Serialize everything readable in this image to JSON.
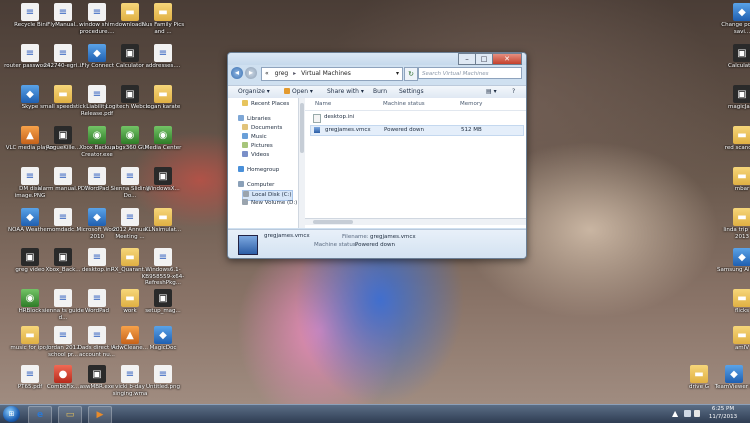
{
  "desktop": {
    "icons": [
      {
        "label": "Recycle Bin",
        "icon": "recycle-bin-icon",
        "kind": "doc"
      },
      {
        "label": "iFlyManual...",
        "icon": "document-icon",
        "kind": "doc"
      },
      {
        "label": "window shim procedure....",
        "icon": "document-icon",
        "kind": "doc"
      },
      {
        "label": "downloads",
        "icon": "folder-icon",
        "kind": "folder"
      },
      {
        "label": "Nus Family Pics and ...",
        "icon": "folder-icon",
        "kind": "folder"
      },
      {
        "label": "router password....",
        "icon": "document-icon",
        "kind": "doc"
      },
      {
        "label": "242740-egri...",
        "icon": "document-icon",
        "kind": "doc"
      },
      {
        "label": "iFly Connect",
        "icon": "app-icon",
        "kind": "app"
      },
      {
        "label": "Calculator",
        "icon": "calculator-icon",
        "kind": "dark"
      },
      {
        "label": "addresses....",
        "icon": "document-icon",
        "kind": "doc"
      },
      {
        "label": "Skype",
        "icon": "skype-icon",
        "kind": "app"
      },
      {
        "label": "small speedstick",
        "icon": "folder-icon",
        "kind": "folder"
      },
      {
        "label": "Liability Release.pdf",
        "icon": "pdf-icon",
        "kind": "doc"
      },
      {
        "label": "Logitech Webca...",
        "icon": "webcam-icon",
        "kind": "dark"
      },
      {
        "label": "logan karate",
        "icon": "folder-icon",
        "kind": "folder"
      },
      {
        "label": "VLC media player",
        "icon": "vlc-icon",
        "kind": "orange"
      },
      {
        "label": "RogueKille...",
        "icon": "app-icon",
        "kind": "dark"
      },
      {
        "label": "Xbox Backup Creator.exe",
        "icon": "app-icon",
        "kind": "green"
      },
      {
        "label": "abgx360 GUI",
        "icon": "app-icon",
        "kind": "green"
      },
      {
        "label": "Media Center",
        "icon": "media-center-icon",
        "kind": "green"
      },
      {
        "label": "DM disk image.PNG",
        "icon": "image-icon",
        "kind": "doc"
      },
      {
        "label": "alarm manual.PDF",
        "icon": "pdf-icon",
        "kind": "doc"
      },
      {
        "label": "WordPad",
        "icon": "wordpad-icon",
        "kind": "doc"
      },
      {
        "label": "Sienna Sliding Do...",
        "icon": "document-icon",
        "kind": "doc"
      },
      {
        "label": "WindowsX...",
        "icon": "app-icon",
        "kind": "dark"
      },
      {
        "label": "NOAA Weathe...",
        "icon": "app-icon",
        "kind": "app"
      },
      {
        "label": "momdadc...",
        "icon": "document-icon",
        "kind": "doc"
      },
      {
        "label": "Microsoft Word 2010",
        "icon": "word-icon",
        "kind": "app"
      },
      {
        "label": "2012 Annual Meeting ...",
        "icon": "document-icon",
        "kind": "doc"
      },
      {
        "label": "KLNsimulat...",
        "icon": "folder-icon",
        "kind": "folder"
      },
      {
        "label": "greg video",
        "icon": "video-icon",
        "kind": "dark"
      },
      {
        "label": "Xbox_Back...",
        "icon": "app-icon",
        "kind": "dark"
      },
      {
        "label": "desktop.ini",
        "icon": "settings-file-icon",
        "kind": "doc"
      },
      {
        "label": "RX_Quarant...",
        "icon": "folder-icon",
        "kind": "folder"
      },
      {
        "label": "Windows6.1-KB958559-x64-RefreshPkg...",
        "icon": "document-icon",
        "kind": "doc"
      },
      {
        "label": "HRBlock",
        "icon": "app-icon",
        "kind": "green"
      },
      {
        "label": "sienna ts guide d...",
        "icon": "document-icon",
        "kind": "doc"
      },
      {
        "label": "WordPad",
        "icon": "wordpad-icon",
        "kind": "doc"
      },
      {
        "label": "work",
        "icon": "folder-icon",
        "kind": "folder"
      },
      {
        "label": "setup_mag...",
        "icon": "app-icon",
        "kind": "dark"
      },
      {
        "label": "music for ipod",
        "icon": "folder-icon",
        "kind": "folder"
      },
      {
        "label": "Jordan 2012 school pr...",
        "icon": "document-icon",
        "kind": "doc"
      },
      {
        "label": "Dads direct tv account nu...",
        "icon": "document-icon",
        "kind": "doc"
      },
      {
        "label": "AdwCleane...",
        "icon": "app-icon",
        "kind": "orange"
      },
      {
        "label": "MagicDoc",
        "icon": "app-icon",
        "kind": "app"
      },
      {
        "label": "PT65.pdf",
        "icon": "pdf-icon",
        "kind": "doc"
      },
      {
        "label": "ComboFix...",
        "icon": "app-icon",
        "kind": "red"
      },
      {
        "label": "aswMBR.exe",
        "icon": "app-icon",
        "kind": "dark"
      },
      {
        "label": "vicki b-day singing.wma",
        "icon": "audio-icon",
        "kind": "doc"
      },
      {
        "label": "Untitled.png",
        "icon": "image-icon",
        "kind": "doc"
      },
      {
        "label": "Change power-savi...",
        "icon": "power-icon",
        "kind": "app"
      },
      {
        "label": "Calculator",
        "icon": "calculator-icon",
        "kind": "dark"
      },
      {
        "label": "magicJack",
        "icon": "app-icon",
        "kind": "dark"
      },
      {
        "label": "red scandisk",
        "icon": "folder-icon",
        "kind": "folder"
      },
      {
        "label": "mbar",
        "icon": "folder-icon",
        "kind": "folder"
      },
      {
        "label": "linda trip pics 2013",
        "icon": "folder-icon",
        "kind": "folder"
      },
      {
        "label": "Samsung AllShare",
        "icon": "app-icon",
        "kind": "app"
      },
      {
        "label": "flicks",
        "icon": "folder-icon",
        "kind": "folder"
      },
      {
        "label": "amIV",
        "icon": "folder-icon",
        "kind": "folder"
      },
      {
        "label": "drive G",
        "icon": "folder-icon",
        "kind": "folder"
      },
      {
        "label": "TeamViewer 8",
        "icon": "teamviewer-icon",
        "kind": "app"
      }
    ]
  },
  "explorer": {
    "address": {
      "prefix": "«",
      "crumb_1": "greg",
      "separator": "▸",
      "crumb_2": "Virtual Machines",
      "dropdown": "▾",
      "refresh": "↻",
      "search_placeholder": "Search Virtual Machines"
    },
    "toolbar": {
      "organize": "Organize ▾",
      "open": "Open ▾",
      "share_with": "Share with ▾",
      "burn": "Burn",
      "settings": "Settings",
      "views": "▤ ▾",
      "help": "?"
    },
    "nav": [
      {
        "label": "Recent Places",
        "icon": "recent-places-icon",
        "color": "#e7c45d"
      },
      {
        "label": "Libraries",
        "icon": "libraries-icon",
        "color": "#7ea7d6"
      },
      {
        "label": "Documents",
        "icon": "documents-icon",
        "color": "#e1c37a"
      },
      {
        "label": "Music",
        "icon": "music-icon",
        "color": "#6a9fd8"
      },
      {
        "label": "Pictures",
        "icon": "pictures-icon",
        "color": "#a7c57b"
      },
      {
        "label": "Videos",
        "icon": "videos-icon",
        "color": "#7a8fc8"
      },
      {
        "label": "Homegroup",
        "icon": "homegroup-icon",
        "color": "#4a90d9"
      },
      {
        "label": "Computer",
        "icon": "computer-icon",
        "color": "#8aa0b8"
      },
      {
        "label": "Local Disk (C:)",
        "icon": "disk-icon",
        "color": "#9aa4ae"
      },
      {
        "label": "New Volume (D:)",
        "icon": "disk-icon",
        "color": "#9aa4ae"
      }
    ],
    "columns": {
      "name": "Name",
      "status": "Machine status",
      "memory": "Memory"
    },
    "files": [
      {
        "name": "desktop.ini",
        "status": "",
        "memory": ""
      },
      {
        "name": "gregjames.vmcx",
        "status": "Powered down",
        "memory": "512 MB"
      }
    ],
    "details": {
      "name": "gregjames.vmcx",
      "filename_label": "Filename:",
      "filename_value": "gregjames.vmcx",
      "status_label": "Machine status:",
      "status_value": "Powered down"
    },
    "window_controls": {
      "minimize": "–",
      "maximize": "□",
      "close": "✕"
    }
  },
  "taskbar": {
    "start_label": "⊞",
    "pinned": [
      {
        "icon": "internet-explorer-icon",
        "glyph": "e",
        "color": "#2a78d4"
      },
      {
        "icon": "windows-explorer-icon",
        "glyph": "▭",
        "color": "#e6c15a"
      },
      {
        "icon": "media-player-icon",
        "glyph": "▶",
        "color": "#e98b2a"
      }
    ],
    "tray_arrow": "▲",
    "time": "6:25 PM",
    "date": "11/7/2013"
  },
  "colors": {
    "taskbar": "#3a4a62",
    "window_frame": "#cfe0f0",
    "selection": "#e4eefa"
  }
}
